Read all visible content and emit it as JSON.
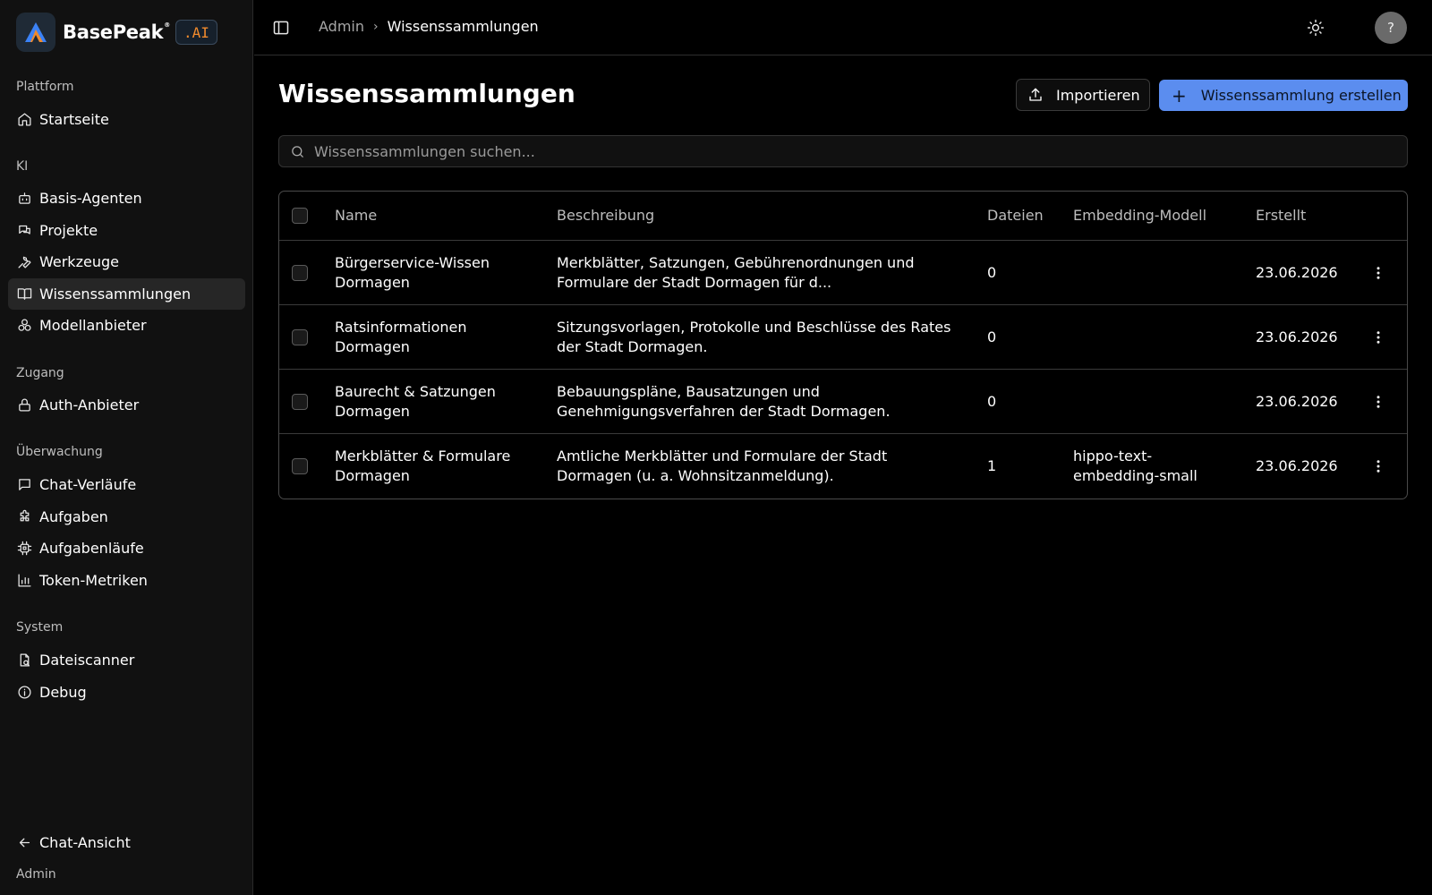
{
  "brand": {
    "name": "BasePeak",
    "registered": "®",
    "badge": ".AI"
  },
  "sidebar": {
    "sections": [
      {
        "label": "Plattform",
        "items": [
          {
            "label": "Startseite",
            "icon": "home-icon"
          }
        ]
      },
      {
        "label": "KI",
        "items": [
          {
            "label": "Basis-Agenten",
            "icon": "bot-icon"
          },
          {
            "label": "Projekte",
            "icon": "chat-bubbles-icon"
          },
          {
            "label": "Werkzeuge",
            "icon": "wrench-icon"
          },
          {
            "label": "Wissenssammlungen",
            "icon": "book-icon",
            "active": true
          },
          {
            "label": "Modellanbieter",
            "icon": "cluster-icon"
          }
        ]
      },
      {
        "label": "Zugang",
        "items": [
          {
            "label": "Auth-Anbieter",
            "icon": "lock-icon"
          }
        ]
      },
      {
        "label": "Überwachung",
        "items": [
          {
            "label": "Chat-Verläufe",
            "icon": "message-square-icon"
          },
          {
            "label": "Aufgaben",
            "icon": "puzzle-icon"
          },
          {
            "label": "Aufgabenläufe",
            "icon": "cpu-icon"
          },
          {
            "label": "Token-Metriken",
            "icon": "bar-chart-icon"
          }
        ]
      },
      {
        "label": "System",
        "items": [
          {
            "label": "Dateiscanner",
            "icon": "file-scan-icon"
          },
          {
            "label": "Debug",
            "icon": "info-icon"
          }
        ]
      }
    ],
    "footer": {
      "chat_view": "Chat-Ansicht",
      "user": "Admin"
    }
  },
  "topbar": {
    "breadcrumb": {
      "parent": "Admin",
      "separator": "›",
      "current": "Wissenssammlungen"
    },
    "avatar": "?"
  },
  "main": {
    "title": "Wissenssammlungen",
    "import_label": "Importieren",
    "create_label": "Wissenssammlung erstellen",
    "search_placeholder": "Wissenssammlungen suchen...",
    "table": {
      "columns": {
        "name": "Name",
        "description": "Beschreibung",
        "files": "Dateien",
        "model": "Embedding-Modell",
        "created": "Erstellt"
      },
      "rows": [
        {
          "name": "Bürgerservice-Wissen Dormagen",
          "description": "Merkblätter, Satzungen, Gebührenordnungen und Formulare der Stadt Dormagen für d...",
          "files": "0",
          "model": "",
          "created": "23.06.2026"
        },
        {
          "name": "Ratsinformationen Dormagen",
          "description": "Sitzungsvorlagen, Protokolle und Beschlüsse des Rates der Stadt Dormagen.",
          "files": "0",
          "model": "",
          "created": "23.06.2026"
        },
        {
          "name": "Baurecht & Satzungen Dormagen",
          "description": "Bebauungspläne, Bausatzungen und Genehmigungsverfahren der Stadt Dormagen.",
          "files": "0",
          "model": "",
          "created": "23.06.2026"
        },
        {
          "name": "Merkblätter & Formulare Dormagen",
          "description": "Amtliche Merkblätter und Formulare der Stadt Dormagen (u. a. Wohnsitzanmeldung).",
          "files": "1",
          "model": "hippo-text-embedding-small",
          "created": "23.06.2026"
        }
      ]
    }
  },
  "colors": {
    "accent": "#5b8def",
    "badge_text": "#f08a2c",
    "background": "#000000",
    "sidebar": "#111111"
  }
}
